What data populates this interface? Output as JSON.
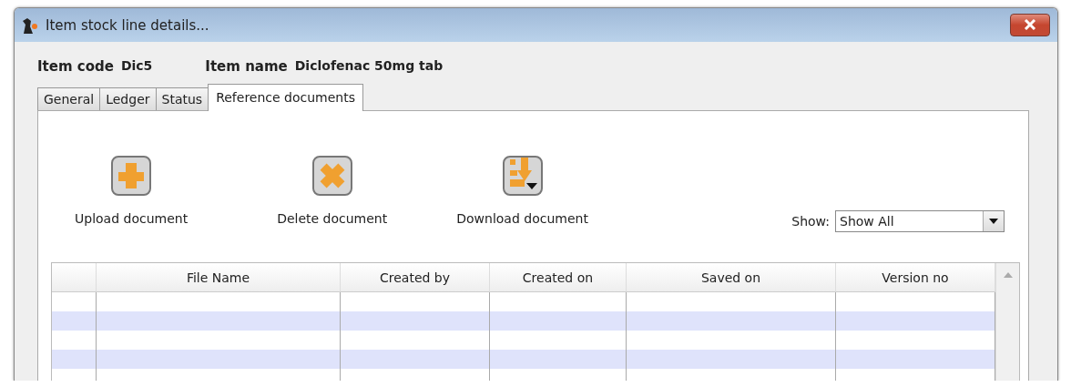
{
  "window": {
    "title": "Item stock line details..."
  },
  "item": {
    "code_label": "Item code",
    "code": "Dic5",
    "name_label": "Item name",
    "name": "Diclofenac 50mg tab"
  },
  "tabs": [
    {
      "label": "General",
      "selected": false
    },
    {
      "label": "Ledger",
      "selected": false
    },
    {
      "label": "Status",
      "selected": false
    },
    {
      "label": "Reference documents",
      "selected": true
    }
  ],
  "toolbar": [
    {
      "kind": "upload",
      "label": "Upload document"
    },
    {
      "kind": "delete",
      "label": "Delete document"
    },
    {
      "kind": "download",
      "label": "Download document"
    }
  ],
  "filter": {
    "label": "Show:",
    "value": "Show All"
  },
  "table": {
    "columns": [
      "",
      "File Name",
      "Created by",
      "Created on",
      "Saved on",
      "Version no"
    ]
  }
}
